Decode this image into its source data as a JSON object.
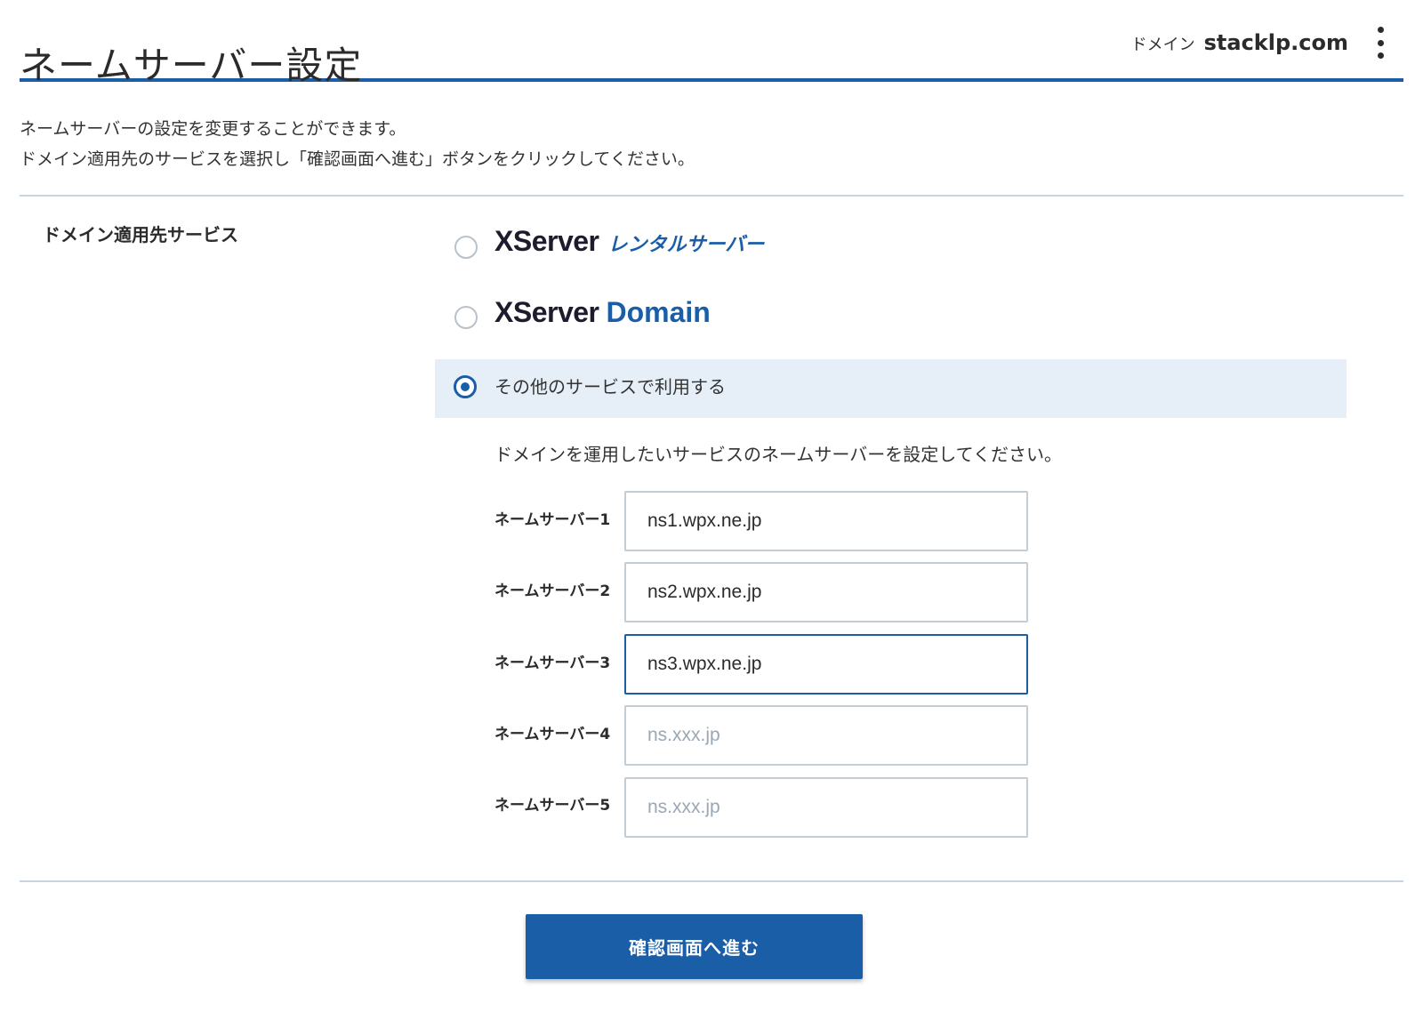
{
  "header": {
    "title": "ネームサーバー設定",
    "domain_label": "ドメイン",
    "domain_name": "stacklp.com",
    "menu_icon": "more-vertical-icon"
  },
  "intro": {
    "line1": "ネームサーバーの設定を変更することができます。",
    "line2": "ドメイン適用先のサービスを選択し「確認画面へ進む」ボタンをクリックしてください。"
  },
  "service": {
    "label": "ドメイン適用先サービス",
    "options": [
      {
        "id": "xserver-rental",
        "logo_main": "XServer",
        "logo_sub": "レンタルサーバー",
        "selected": false
      },
      {
        "id": "xserver-domain",
        "logo_main": "XServer",
        "logo_sub": "Domain",
        "selected": false
      },
      {
        "id": "other",
        "label": "その他のサービスで利用する",
        "selected": true
      }
    ]
  },
  "nameservers": {
    "instruction": "ドメインを運用したいサービスのネームサーバーを設定してください。",
    "items": [
      {
        "label": "ネームサーバー1",
        "value": "ns1.wpx.ne.jp",
        "placeholder": "ns.xxx.jp"
      },
      {
        "label": "ネームサーバー2",
        "value": "ns2.wpx.ne.jp",
        "placeholder": "ns.xxx.jp"
      },
      {
        "label": "ネームサーバー3",
        "value": "ns3.wpx.ne.jp",
        "placeholder": "ns.xxx.jp"
      },
      {
        "label": "ネームサーバー4",
        "value": "",
        "placeholder": "ns.xxx.jp"
      },
      {
        "label": "ネームサーバー5",
        "value": "",
        "placeholder": "ns.xxx.jp"
      }
    ]
  },
  "actions": {
    "submit_label": "確認画面へ進む"
  },
  "colors": {
    "accent": "#1a5ea8",
    "selected_bg": "#e6eef7",
    "divider": "#c7d3df",
    "input_border": "#c4ccd4"
  }
}
